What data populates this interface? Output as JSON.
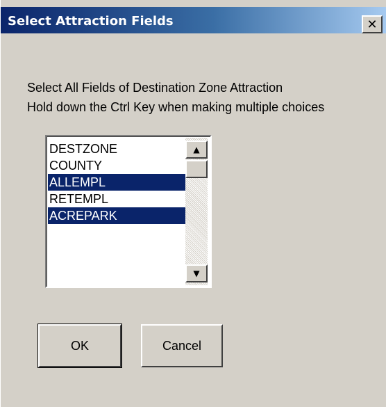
{
  "window": {
    "title": "Select Attraction Fields",
    "close_glyph": "✕"
  },
  "instructions": {
    "line1": "Select All Fields of Destination Zone Attraction",
    "line2": "Hold down the Ctrl Key when making multiple choices"
  },
  "fields_list": {
    "items": [
      {
        "label": "DESTZONE",
        "selected": false
      },
      {
        "label": "COUNTY",
        "selected": false
      },
      {
        "label": "ALLEMPL",
        "selected": true
      },
      {
        "label": "RETEMPL",
        "selected": false
      },
      {
        "label": "ACREPARK",
        "selected": true
      }
    ],
    "scroll_up_glyph": "▲",
    "scroll_down_glyph": "▼"
  },
  "buttons": {
    "ok_label": "OK",
    "cancel_label": "Cancel"
  },
  "colors": {
    "face": "#d4d0c8",
    "selection": "#0a246a",
    "title_gradient_start": "#0a246a",
    "title_gradient_end": "#a6caf0"
  }
}
